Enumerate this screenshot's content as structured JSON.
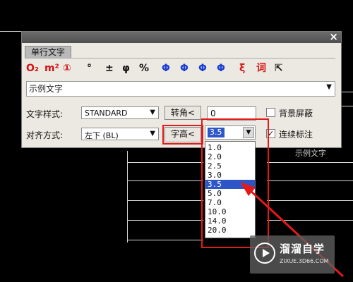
{
  "tab": {
    "label": "单行文字"
  },
  "toolbar": {
    "icons": [
      {
        "text": "O₂",
        "name": "subscript-icon"
      },
      {
        "text": "m²",
        "name": "superscript-icon"
      },
      {
        "text": "①",
        "name": "circled-number-icon"
      },
      {
        "text": "°",
        "name": "degree-icon"
      },
      {
        "text": "±",
        "name": "plus-minus-icon"
      },
      {
        "text": "φ",
        "name": "diameter-icon"
      },
      {
        "text": "%",
        "name": "percent-icon"
      },
      {
        "text": "Φ",
        "name": "steel-grade-1-icon"
      },
      {
        "text": "Φ",
        "name": "steel-grade-2-icon"
      },
      {
        "text": "Φ",
        "name": "steel-grade-3-icon"
      },
      {
        "text": "Φ",
        "name": "steel-grade-4-icon"
      },
      {
        "text": "ξ",
        "name": "special-char-icon"
      },
      {
        "text": "词",
        "name": "phrase-icon"
      },
      {
        "text": "⇱",
        "name": "pick-cursor-icon"
      }
    ]
  },
  "sample": {
    "text": "示例文字"
  },
  "style_row": {
    "label": "文字样式:",
    "value": "STANDARD",
    "rotate_button": "转角<",
    "rotate_value": "0",
    "mask_label": "背景屏蔽"
  },
  "align_row": {
    "label": "对齐方式:",
    "value": "左下  (BL)",
    "height_button": "字高<",
    "height_value": "3.5",
    "continuous_label": "连续标注"
  },
  "height_options": [
    "1.0",
    "2.0",
    "2.5",
    "3.0",
    "3.5",
    "5.0",
    "7.0",
    "10.0",
    "14.0",
    "20.0"
  ],
  "selected_height": "3.5",
  "canvas": {
    "text": "示例文字"
  },
  "watermark": {
    "title": "溜溜自学",
    "url": "ZIXUE.3D66.COM"
  },
  "colors": {
    "accent_red": "#e31a1a",
    "selection_blue": "#2e56c8"
  }
}
